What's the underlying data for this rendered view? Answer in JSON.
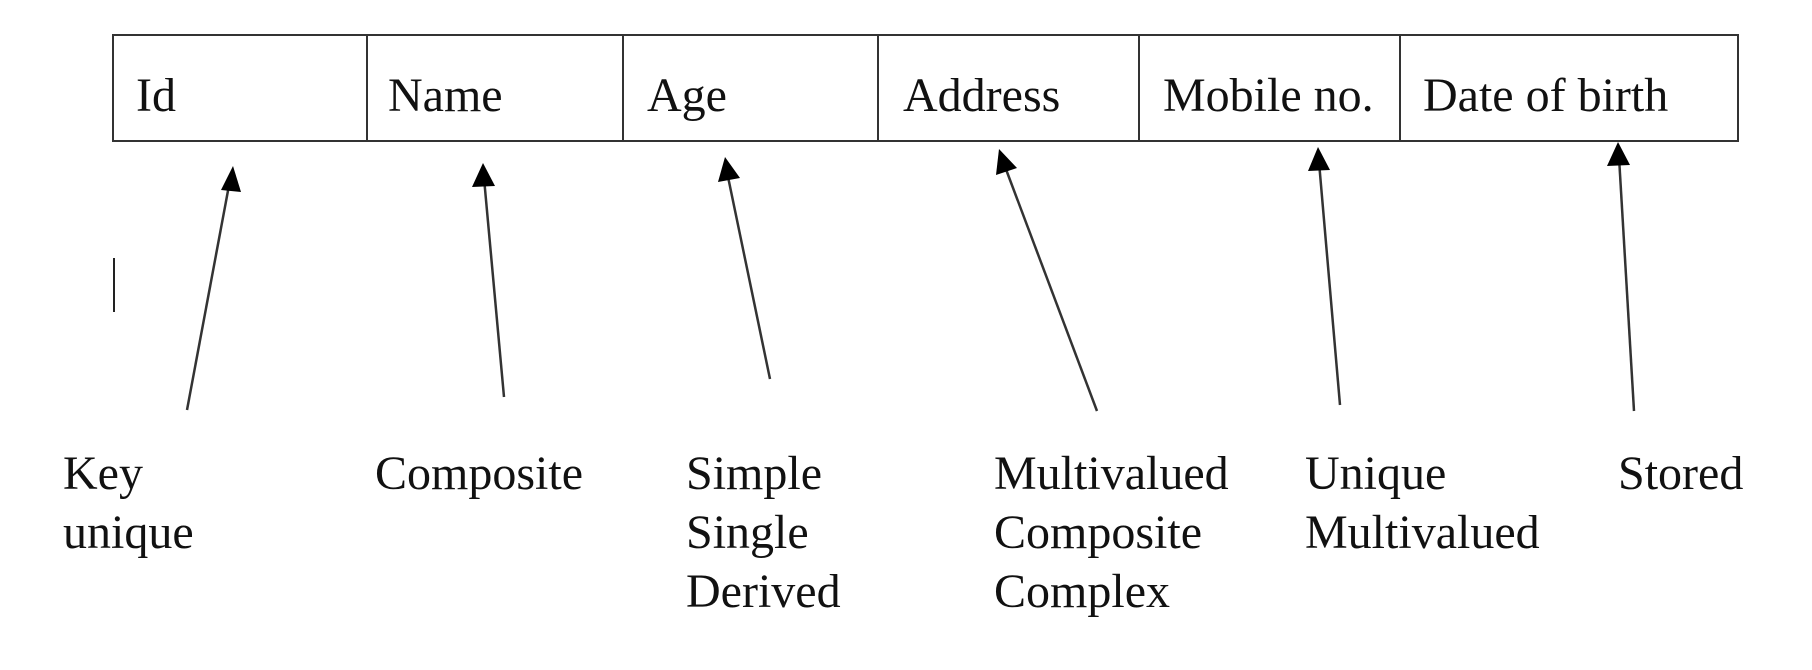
{
  "diagram": {
    "title": "",
    "type": "entity-attribute-types",
    "line_color": "#333333",
    "text_color": "#111111",
    "attributes": [
      {
        "name": "Id",
        "types": [
          "Key",
          "unique"
        ]
      },
      {
        "name": "Name",
        "types": [
          "Composite"
        ]
      },
      {
        "name": "Age",
        "types": [
          "Simple",
          "Single",
          "Derived"
        ]
      },
      {
        "name": "Address",
        "types": [
          "Multivalued",
          "Composite",
          "Complex"
        ]
      },
      {
        "name": "Mobile no.",
        "types": [
          "Unique",
          "Multivalued"
        ]
      },
      {
        "name": "Date of birth",
        "types": [
          "Stored"
        ]
      }
    ],
    "connections": [
      {
        "from": "Key / unique",
        "to": "Id"
      },
      {
        "from": "Composite",
        "to": "Name"
      },
      {
        "from": "Simple / Single / Derived",
        "to": "Age"
      },
      {
        "from": "Multivalued / Composite / Complex",
        "to": "Address"
      },
      {
        "from": "Unique / Multivalued",
        "to": "Mobile no."
      },
      {
        "from": "Stored",
        "to": "Date of birth"
      }
    ]
  }
}
